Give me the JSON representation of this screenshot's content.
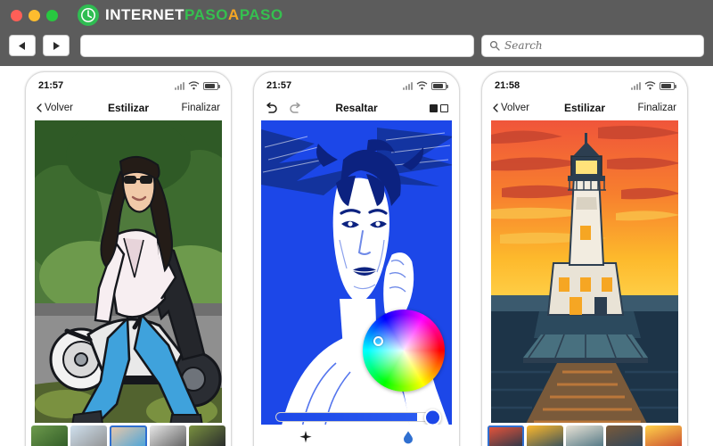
{
  "browser": {
    "traffic_lights": [
      "close",
      "minimize",
      "maximize"
    ],
    "brand": {
      "part1": "INTERNET",
      "part2": "PASO",
      "part3": "A",
      "part4": "PASO"
    },
    "nav": {
      "back_label": "◀",
      "forward_label": "▶"
    },
    "url_value": "",
    "url_placeholder": "",
    "search": {
      "placeholder": "Search",
      "value": "Search",
      "icon": "search-icon"
    }
  },
  "phones": [
    {
      "id": "phone-1",
      "status": {
        "time": "21:57",
        "signal": "signal-icon",
        "wifi": "wifi-icon",
        "battery": "battery-icon"
      },
      "appbar": {
        "back": "Volver",
        "title": "Estilizar",
        "action": "Finalizar"
      },
      "artwork": "woman-on-scooter-comic",
      "thumbnails": [
        "thumb-1",
        "thumb-2",
        "thumb-3",
        "thumb-4",
        "thumb-5"
      ],
      "selected_thumbnail": 2
    },
    {
      "id": "phone-2",
      "status": {
        "time": "21:57",
        "signal": "signal-icon",
        "wifi": "wifi-icon",
        "battery": "battery-icon"
      },
      "appbar": {
        "back": "undo-icon",
        "forward": "redo-icon",
        "title": "Resaltar",
        "pages": "page-indicator"
      },
      "artwork": "blue-white-portrait",
      "color_wheel": {
        "name": "color-wheel",
        "knob_position": "upper-left"
      },
      "slider": {
        "name": "brush-size-slider",
        "value_percent": 88,
        "color": "#1c47e8"
      },
      "tools": [
        "sparkle-icon",
        "droplet-icon"
      ]
    },
    {
      "id": "phone-3",
      "status": {
        "time": "21:58",
        "signal": "signal-icon",
        "wifi": "wifi-icon",
        "battery": "battery-icon"
      },
      "appbar": {
        "back": "Volver",
        "title": "Estilizar",
        "action": "Finalizar"
      },
      "artwork": "lighthouse-sunset-poster",
      "thumbnails": [
        "thumb-1",
        "thumb-2",
        "thumb-3",
        "thumb-4",
        "thumb-5"
      ],
      "selected_thumbnail": 0
    }
  ],
  "colors": {
    "chrome": "#5c5c5c",
    "brand_green": "#35c04f",
    "brand_orange": "#f5a623",
    "accent_blue": "#1c47e8",
    "selection_blue": "#2f6fd0"
  }
}
